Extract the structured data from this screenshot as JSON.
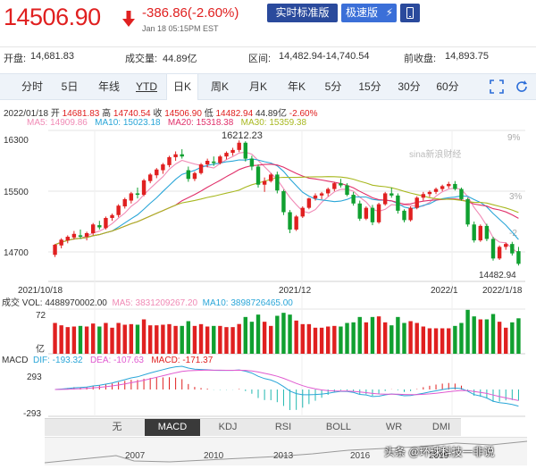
{
  "header": {
    "price": "14506.90",
    "change": "-386.86(-2.60%)",
    "datetime": "Jan 18 05:15PM EST",
    "realtime_btn": "实时标准版",
    "fast_btn": "极速版",
    "colors": {
      "down": "#e02020",
      "up": "#10a030",
      "btn": "#2a4a9c"
    }
  },
  "info": [
    {
      "label": "开盘:",
      "value": "14,681.83"
    },
    {
      "label": "成交量:",
      "value": "44.89亿"
    },
    {
      "label": "区间:",
      "value": "14,482.94-14,740.54"
    },
    {
      "label": "前收盘:",
      "value": "14,893.75"
    }
  ],
  "tabs": [
    "分时",
    "5日",
    "年线",
    "YTD",
    "日K",
    "周K",
    "月K",
    "年K",
    "5分",
    "15分",
    "30分",
    "60分"
  ],
  "active_tab": "日K",
  "ohlc": {
    "date": "2022/01/18",
    "open_label": "开",
    "open": "14681.83",
    "high_label": "高",
    "high": "14740.54",
    "close_label": "收",
    "close": "14506.90",
    "low_label": "低",
    "low": "14482.94",
    "vol": "44.89亿",
    "pct": "-2.60%"
  },
  "ma": [
    {
      "label": "MA5: 14909.86",
      "color": "#f08ab5"
    },
    {
      "label": "MA10: 15023.18",
      "color": "#2aa6d8"
    },
    {
      "label": "MA20: 15318.38",
      "color": "#e0306a"
    },
    {
      "label": "MA30: 15359.38",
      "color": "#a8b820"
    }
  ],
  "chart_labels": {
    "y_ticks": [
      "16300",
      "15500",
      "14700"
    ],
    "pct_ticks": [
      "9%",
      "3%",
      "-2"
    ],
    "x_ticks": [
      "2021/10/18",
      "2021/12",
      "2022/1",
      "2022/1/18"
    ],
    "max_label": "16212.23",
    "min_label": "14482.94",
    "logo": "sina新浪财经"
  },
  "volume": {
    "label_prefix": "成交",
    "vol": "VOL: 4488970002.00",
    "ma5": "MA5: 3831209267.20",
    "ma10": "MA10: 3898726465.00",
    "y_top": "72",
    "y_unit": "亿"
  },
  "macd": {
    "label": "MACD",
    "dif": "DIF: -193.32",
    "dea": "DEA: -107.63",
    "macd": "MACD: -171.37",
    "y_top": "293",
    "y_bottom": "-293"
  },
  "indicator_tabs": [
    "无",
    "MACD",
    "KDJ",
    "RSI",
    "BOLL",
    "WR",
    "DMI"
  ],
  "active_indicator": "MACD",
  "timeline_years": [
    "2007",
    "2010",
    "2013",
    "2016",
    "2019"
  ],
  "watermark": "头条 @环球科技一非说",
  "chart_data": {
    "type": "candlestick",
    "title": "",
    "ylim": [
      14300,
      16350
    ],
    "candles": [
      [
        14630,
        14780,
        14600,
        14770
      ],
      [
        14760,
        14860,
        14720,
        14840
      ],
      [
        14830,
        14900,
        14790,
        14880
      ],
      [
        14870,
        14960,
        14840,
        14920
      ],
      [
        14900,
        14980,
        14850,
        14880
      ],
      [
        14880,
        14950,
        14830,
        14930
      ],
      [
        14930,
        15070,
        14900,
        15050
      ],
      [
        15040,
        15100,
        14980,
        15010
      ],
      [
        15000,
        15160,
        14980,
        15140
      ],
      [
        15140,
        15200,
        15100,
        15180
      ],
      [
        15180,
        15330,
        15150,
        15310
      ],
      [
        15300,
        15420,
        15270,
        15400
      ],
      [
        15380,
        15500,
        15340,
        15480
      ],
      [
        15480,
        15560,
        15410,
        15460
      ],
      [
        15460,
        15680,
        15440,
        15660
      ],
      [
        15650,
        15760,
        15620,
        15740
      ],
      [
        15730,
        15830,
        15690,
        15810
      ],
      [
        15800,
        15900,
        15750,
        15880
      ],
      [
        15870,
        16000,
        15840,
        15980
      ],
      [
        15980,
        16060,
        15930,
        16020
      ],
      [
        16020,
        16090,
        15960,
        15990
      ],
      [
        15800,
        15850,
        15640,
        15680
      ],
      [
        15680,
        15780,
        15650,
        15760
      ],
      [
        15760,
        15900,
        15740,
        15880
      ],
      [
        15880,
        15960,
        15840,
        15930
      ],
      [
        15920,
        15990,
        15860,
        15900
      ],
      [
        15900,
        16010,
        15880,
        15990
      ],
      [
        15990,
        16060,
        15950,
        16040
      ],
      [
        16040,
        16110,
        16000,
        16080
      ],
      [
        16080,
        16212,
        16050,
        16180
      ],
      [
        16180,
        16200,
        15920,
        15960
      ],
      [
        15960,
        16000,
        15800,
        15850
      ],
      [
        15850,
        15880,
        15560,
        15600
      ],
      [
        15600,
        15700,
        15500,
        15650
      ],
      [
        15650,
        15760,
        15630,
        15740
      ],
      [
        15740,
        15780,
        15480,
        15520
      ],
      [
        15510,
        15530,
        15180,
        15220
      ],
      [
        15220,
        15250,
        14930,
        14980
      ],
      [
        14980,
        15180,
        14960,
        15160
      ],
      [
        15160,
        15300,
        15140,
        15280
      ],
      [
        15280,
        15420,
        15260,
        15410
      ],
      [
        15410,
        15480,
        15380,
        15450
      ],
      [
        15450,
        15500,
        15400,
        15480
      ],
      [
        15480,
        15560,
        15440,
        15540
      ],
      [
        15540,
        15640,
        15510,
        15620
      ],
      [
        15620,
        15680,
        15560,
        15590
      ],
      [
        15590,
        15620,
        15440,
        15460
      ],
      [
        15460,
        15500,
        15310,
        15340
      ],
      [
        15340,
        15380,
        15100,
        15130
      ],
      [
        15130,
        15300,
        15110,
        15280
      ],
      [
        15280,
        15320,
        15040,
        15080
      ],
      [
        15080,
        15350,
        15060,
        15330
      ],
      [
        15330,
        15500,
        15310,
        15480
      ],
      [
        15480,
        15560,
        15420,
        15450
      ],
      [
        15450,
        15480,
        15200,
        15240
      ],
      [
        15240,
        15260,
        15080,
        15110
      ],
      [
        15110,
        15300,
        15090,
        15280
      ],
      [
        15280,
        15440,
        15260,
        15420
      ],
      [
        15420,
        15500,
        15380,
        15470
      ],
      [
        15470,
        15520,
        15430,
        15500
      ],
      [
        15500,
        15560,
        15470,
        15540
      ],
      [
        15540,
        15600,
        15510,
        15580
      ],
      [
        15580,
        15640,
        15550,
        15610
      ],
      [
        15610,
        15650,
        15520,
        15540
      ],
      [
        15540,
        15560,
        15380,
        15400
      ],
      [
        15400,
        15420,
        15020,
        15050
      ],
      [
        15050,
        15090,
        14800,
        14830
      ],
      [
        14830,
        15050,
        14810,
        15030
      ],
      [
        15030,
        15060,
        14820,
        14850
      ],
      [
        14850,
        14880,
        14550,
        14580
      ],
      [
        14580,
        14760,
        14560,
        14740
      ],
      [
        14740,
        14800,
        14700,
        14780
      ],
      [
        14780,
        14810,
        14620,
        14650
      ],
      [
        14681,
        14740,
        14482,
        14506
      ]
    ]
  }
}
